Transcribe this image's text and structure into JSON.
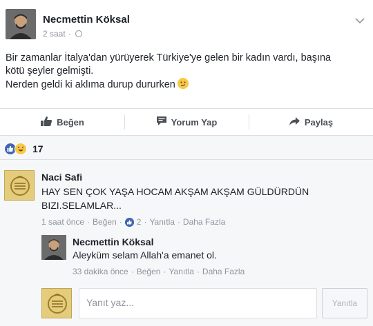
{
  "post": {
    "author": "Necmettin Köksal",
    "time": "2 saat",
    "time_sep": "·",
    "lines": [
      "Bir zamanlar İtalya'dan yürüyerek Türkiye'ye gelen bir kadın vardı, başına",
      "kötü şeyler gelmişti.",
      "Nerden geldi ki aklıma durup dururken"
    ]
  },
  "actions": {
    "like": "Beğen",
    "comment": "Yorum Yap",
    "share": "Paylaş"
  },
  "reactions": {
    "count": "17"
  },
  "comment1": {
    "author": "Naci Safi",
    "line1": "HAY SEN ÇOK YAŞA HOCAM AKŞAM AKŞAM GÜLDÜRDÜN",
    "line2": "BIZI.SELAMLAR...",
    "time": "1 saat önce",
    "like": "Beğen",
    "like_count": "2",
    "reply": "Yanıtla",
    "more": "Daha Fazla",
    "sep": "·"
  },
  "comment2": {
    "author": "Necmettin Köksal",
    "text": "Aleyküm selam Allah'a emanet ol.",
    "time": "33 dakika önce",
    "like": "Beğen",
    "reply": "Yanıtla",
    "more": "Daha Fazla",
    "sep": "·"
  },
  "compose": {
    "placeholder": "Yanıt yaz...",
    "button": "Yanıtla"
  },
  "colors": {
    "link_blue": "#4267b2",
    "meta_gray": "#90949c",
    "background": "#f6f7f9"
  }
}
